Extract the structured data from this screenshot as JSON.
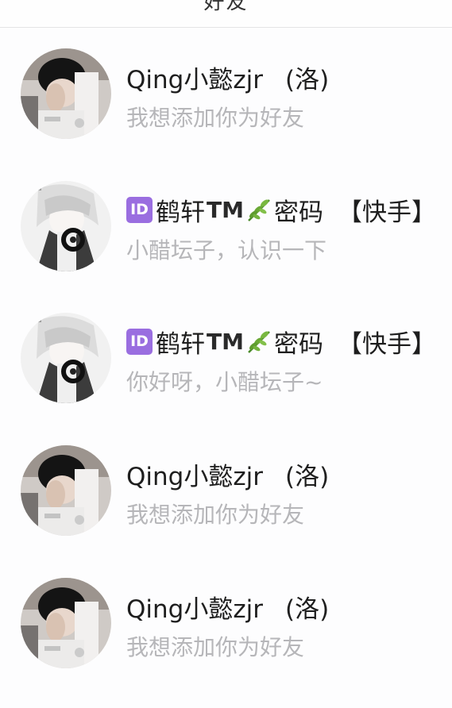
{
  "header": {
    "title_partial": "好友"
  },
  "requests": [
    {
      "avatar": "boy-covering-face-avatar",
      "name": "Qing小懿zjr",
      "suffix": "(洛)",
      "message": "我想添加你为好友"
    },
    {
      "avatar": "anime-boy-headphones-avatar",
      "badge": "ID",
      "name": "鹤轩",
      "tm": "TM",
      "leaf_icon": "herb-icon",
      "name_after_leaf": "密码",
      "tag": "【快手】",
      "message": "小醋坛子，认识一下"
    },
    {
      "avatar": "anime-boy-headphones-avatar",
      "badge": "ID",
      "name": "鹤轩",
      "tm": "TM",
      "leaf_icon": "herb-icon",
      "name_after_leaf": "密码",
      "tag": "【快手】",
      "message": "你好呀，小醋坛子~"
    },
    {
      "avatar": "boy-covering-face-avatar",
      "name": "Qing小懿zjr",
      "suffix": "(洛)",
      "message": "我想添加你为好友"
    },
    {
      "avatar": "boy-covering-face-avatar",
      "name": "Qing小懿zjr",
      "suffix": "(洛)",
      "message": "我想添加你为好友"
    }
  ]
}
